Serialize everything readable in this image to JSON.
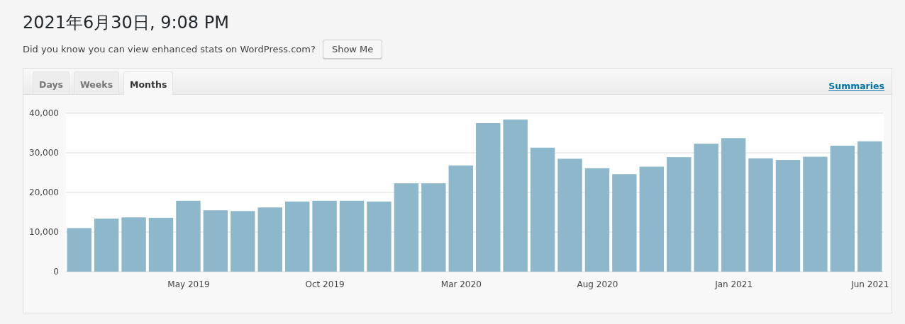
{
  "title": "2021年6月30日, 9:08 PM",
  "notice": {
    "text": "Did you know you can view enhanced stats on WordPress.com?",
    "button": "Show Me"
  },
  "tabs": [
    {
      "label": "Days",
      "selected": false
    },
    {
      "label": "Weeks",
      "selected": false
    },
    {
      "label": "Months",
      "selected": true
    }
  ],
  "summaries_link": "Summaries",
  "chart_data": {
    "type": "bar",
    "categories": [
      null,
      null,
      null,
      null,
      "May 2019",
      null,
      null,
      null,
      null,
      "Oct 2019",
      null,
      null,
      null,
      null,
      "Mar 2020",
      null,
      null,
      null,
      null,
      "Aug 2020",
      null,
      null,
      null,
      null,
      "Jan 2021",
      null,
      null,
      null,
      null,
      "Jun 2021"
    ],
    "values": [
      11000,
      13400,
      13700,
      13600,
      17900,
      15500,
      15300,
      16200,
      17700,
      17900,
      17900,
      17700,
      22300,
      22300,
      26800,
      37500,
      38400,
      31300,
      28500,
      26100,
      24600,
      26500,
      28900,
      32300,
      33700,
      28600,
      28200,
      29000,
      31800,
      32900
    ],
    "ylim": [
      0,
      40000
    ],
    "yticks": [
      0,
      {
        "value": 10000,
        "label": "10,000"
      },
      {
        "value": 20000,
        "label": "20,000"
      },
      {
        "value": 30000,
        "label": "30,000"
      },
      {
        "value": 40000,
        "label": "40,000"
      }
    ],
    "grid": true
  }
}
